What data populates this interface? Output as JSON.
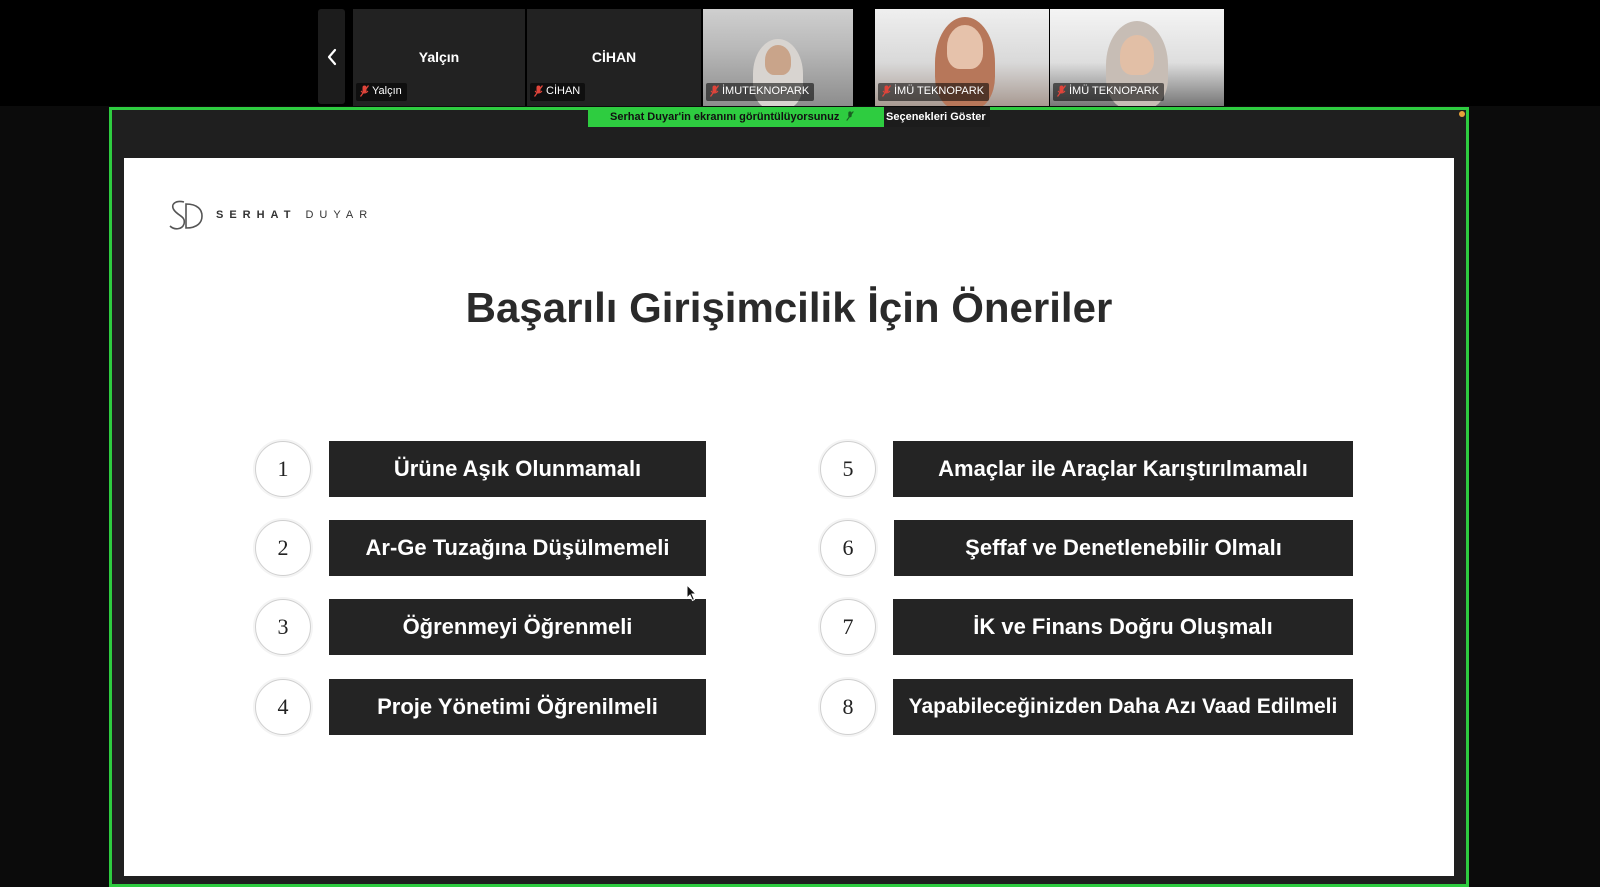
{
  "meeting": {
    "participants": [
      {
        "name": "Yalçın",
        "label": "Yalçın",
        "video": false
      },
      {
        "name": "CİHAN",
        "label": "CİHAN",
        "video": false
      },
      {
        "name": "",
        "label": "İMUTEKNOPARK",
        "video": true
      },
      {
        "name": "",
        "label": "İMÜ TEKNOPARK",
        "video": true
      },
      {
        "name": "",
        "label": "İMÜ TEKNOPARK",
        "video": true
      }
    ],
    "share_banner": "Serhat Duyar'in ekranını görüntülüyorsunuz",
    "options_label": "Seçenekleri Göster"
  },
  "slide": {
    "logo_mark": "SD",
    "logo_first": "SERHAT",
    "logo_last": "DUYAR",
    "title": "Başarılı Girişimcilik İçin Öneriler",
    "items": [
      {
        "number": "1",
        "text": "Ürüne Aşık Olunmamalı"
      },
      {
        "number": "2",
        "text": "Ar-Ge Tuzağına Düşülmemeli"
      },
      {
        "number": "3",
        "text": "Öğrenmeyi Öğrenmeli"
      },
      {
        "number": "4",
        "text": "Proje Yönetimi Öğrenilmeli"
      },
      {
        "number": "5",
        "text": "Amaçlar ile Araçlar Karıştırılmamalı"
      },
      {
        "number": "6",
        "text": "Şeffaf ve Denetlenebilir Olmalı"
      },
      {
        "number": "7",
        "text": "İK ve Finans Doğru Oluşmalı"
      },
      {
        "number": "8",
        "text": "Yapabileceğinizden Daha Azı Vaad Edilmeli"
      }
    ]
  },
  "colors": {
    "share_border": "#2ecc40",
    "pill_bg": "#242424",
    "mic_muted": "#e0443a"
  }
}
